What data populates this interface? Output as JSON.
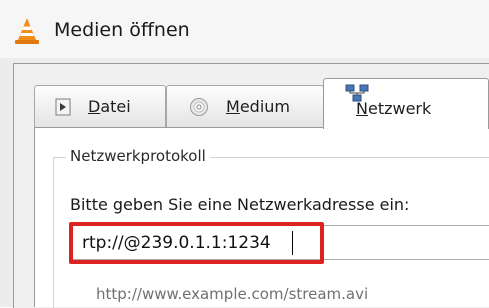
{
  "window": {
    "title": "Medien öffnen",
    "icon": "vlc-cone-icon"
  },
  "tabs": [
    {
      "id": "datei",
      "label_prefix": "",
      "label_underline": "D",
      "label_rest": "atei",
      "icon": "file-play-icon",
      "active": false
    },
    {
      "id": "medium",
      "label_prefix": "",
      "label_underline": "M",
      "label_rest": "edium",
      "icon": "disc-icon",
      "active": false
    },
    {
      "id": "netzwerk",
      "label_prefix": "",
      "label_underline": "N",
      "label_rest": "etzwerk",
      "icon": "network-icon",
      "active": true
    }
  ],
  "network": {
    "group_title": "Netzwerkprotokoll",
    "prompt": "Bitte geben Sie eine Netzwerkadresse ein:",
    "address_value": "rtp://@239.0.1.1:1234",
    "example": "http://www.example.com/stream.avi"
  },
  "colors": {
    "highlight": "#dd2222",
    "vlc_orange": "#f28c1b"
  }
}
